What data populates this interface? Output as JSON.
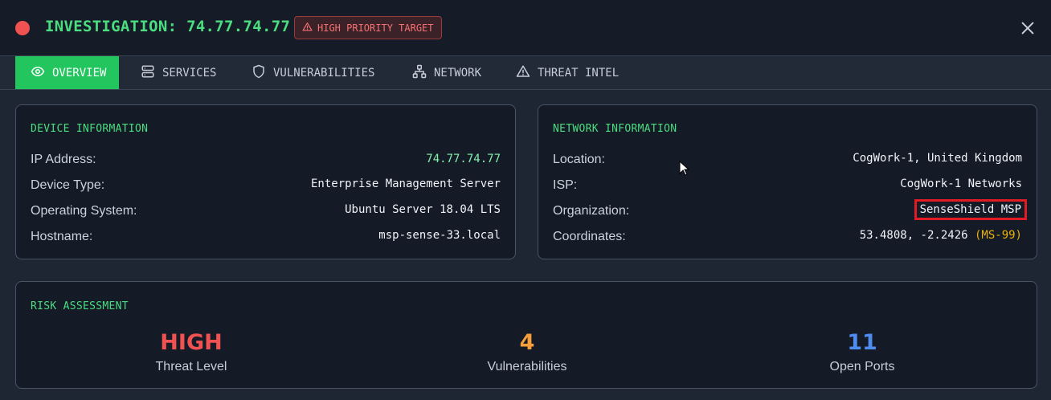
{
  "header": {
    "title": "INVESTIGATION: 74.77.74.77",
    "badge": "HIGH PRIORITY TARGET",
    "status_color": "#f05252",
    "title_color": "#4ade80",
    "badge_color": "#f87171"
  },
  "tabs": [
    {
      "label": "OVERVIEW",
      "icon": "eye-icon",
      "active": true
    },
    {
      "label": "SERVICES",
      "icon": "server-icon",
      "active": false
    },
    {
      "label": "VULNERABILITIES",
      "icon": "shield-icon",
      "active": false
    },
    {
      "label": "NETWORK",
      "icon": "network-icon",
      "active": false
    },
    {
      "label": "THREAT INTEL",
      "icon": "warning-icon",
      "active": false
    }
  ],
  "device": {
    "title": "DEVICE INFORMATION",
    "rows": [
      {
        "label": "IP Address:",
        "value": "74.77.74.77"
      },
      {
        "label": "Device Type:",
        "value": "Enterprise Management Server"
      },
      {
        "label": "Operating System:",
        "value": "Ubuntu Server 18.04 LTS"
      },
      {
        "label": "Hostname:",
        "value": "msp-sense-33.local"
      }
    ]
  },
  "network": {
    "title": "NETWORK INFORMATION",
    "rows": [
      {
        "label": "Location:",
        "value": "CogWork-1, United Kingdom"
      },
      {
        "label": "ISP:",
        "value": "CogWork-1 Networks"
      },
      {
        "label": "Organization:",
        "value": "SenseShield MSP"
      },
      {
        "label": "Coordinates:",
        "value": "53.4808, -2.2426",
        "suffix": "(MS-99)"
      }
    ]
  },
  "risk": {
    "title": "RISK ASSESSMENT",
    "items": [
      {
        "value": "HIGH",
        "label": "Threat Level",
        "color": "#f05252"
      },
      {
        "value": "4",
        "label": "Vulnerabilities",
        "color": "#f59e3b"
      },
      {
        "value": "11",
        "label": "Open Ports",
        "color": "#4f8cf0"
      }
    ]
  },
  "colors": {
    "accent_green": "#4ade80",
    "active_tab": "#22c55e",
    "ip_value": "#86efac",
    "suffix": "#eab308"
  }
}
